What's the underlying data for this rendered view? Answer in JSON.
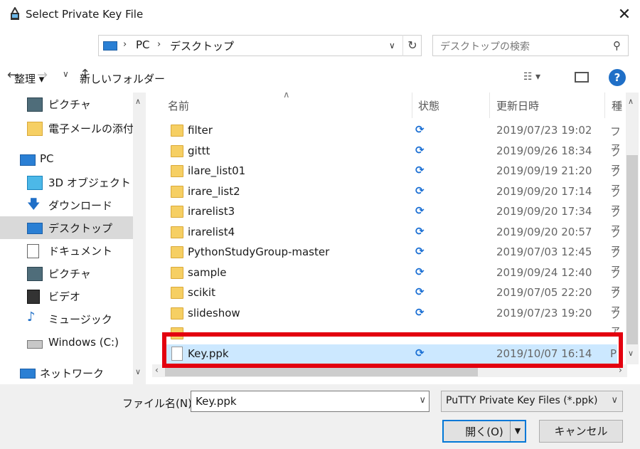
{
  "window": {
    "title": "Select Private Key File"
  },
  "address": {
    "segments": [
      "PC",
      "デスクトップ"
    ]
  },
  "search": {
    "placeholder": "デスクトップの検索"
  },
  "toolbar": {
    "organize": "整理 ▾",
    "new_folder": "新しいフォルダー"
  },
  "nav": {
    "items": [
      {
        "label": "ピクチャ",
        "icon": "pictures-icon"
      },
      {
        "label": "電子メールの添付フ",
        "icon": "folder-icon"
      },
      {
        "label": "PC",
        "icon": "pc-icon"
      },
      {
        "label": "3D オブジェクト",
        "icon": "3d-objects-icon"
      },
      {
        "label": "ダウンロード",
        "icon": "download-icon"
      },
      {
        "label": "デスクトップ",
        "icon": "desktop-icon"
      },
      {
        "label": "ドキュメント",
        "icon": "documents-icon"
      },
      {
        "label": "ピクチャ",
        "icon": "pictures-icon"
      },
      {
        "label": "ビデオ",
        "icon": "video-icon"
      },
      {
        "label": "ミュージック",
        "icon": "music-icon"
      },
      {
        "label": "Windows (C:)",
        "icon": "drive-icon"
      },
      {
        "label": "ネットワーク",
        "icon": "network-icon"
      }
    ]
  },
  "columns": {
    "name": "名前",
    "status": "状態",
    "date": "更新日時",
    "type": "種"
  },
  "files": [
    {
      "name": "filter",
      "date": "2019/07/23 19:02",
      "type": "ファ"
    },
    {
      "name": "gittt",
      "date": "2019/09/26 18:34",
      "type": "ファ"
    },
    {
      "name": "ilare_list01",
      "date": "2019/09/19 21:20",
      "type": "ファ"
    },
    {
      "name": "irare_list2",
      "date": "2019/09/20 17:14",
      "type": "ファ"
    },
    {
      "name": "irarelist3",
      "date": "2019/09/20 17:34",
      "type": "ファ"
    },
    {
      "name": "irarelist4",
      "date": "2019/09/20 20:57",
      "type": "ファ"
    },
    {
      "name": "PythonStudyGroup-master",
      "date": "2019/07/03 12:45",
      "type": "ファ"
    },
    {
      "name": "sample",
      "date": "2019/09/24 12:40",
      "type": "ファ"
    },
    {
      "name": "scikit",
      "date": "2019/07/05 22:20",
      "type": "ファ"
    },
    {
      "name": "slideshow",
      "date": "2019/07/23 19:20",
      "type": "ファ"
    }
  ],
  "selected_file": {
    "name": "Key.ppk",
    "date": "2019/10/07 16:14",
    "type": "P"
  },
  "bottom": {
    "filename_label": "ファイル名(N):",
    "filename_value": "Key.ppk",
    "filter": "PuTTY Private Key Files (*.ppk)",
    "open": "開く(O)",
    "cancel": "キャンセル"
  }
}
